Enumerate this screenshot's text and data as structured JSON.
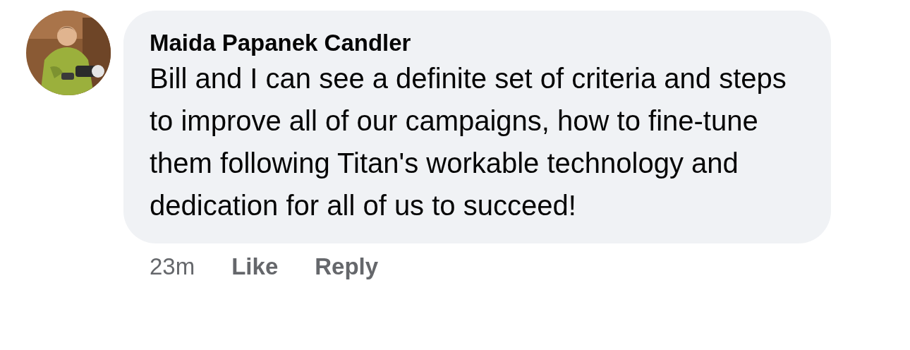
{
  "comment": {
    "author": "Maida Papanek Candler",
    "text": "Bill and I can see a definite set of criteria and steps to improve all of our campaigns, how to fine-tune them following Titan's workable technology and dedication for all of us to succeed!",
    "time": "23m",
    "actions": [
      {
        "label": "Like"
      },
      {
        "label": "Reply"
      }
    ]
  }
}
